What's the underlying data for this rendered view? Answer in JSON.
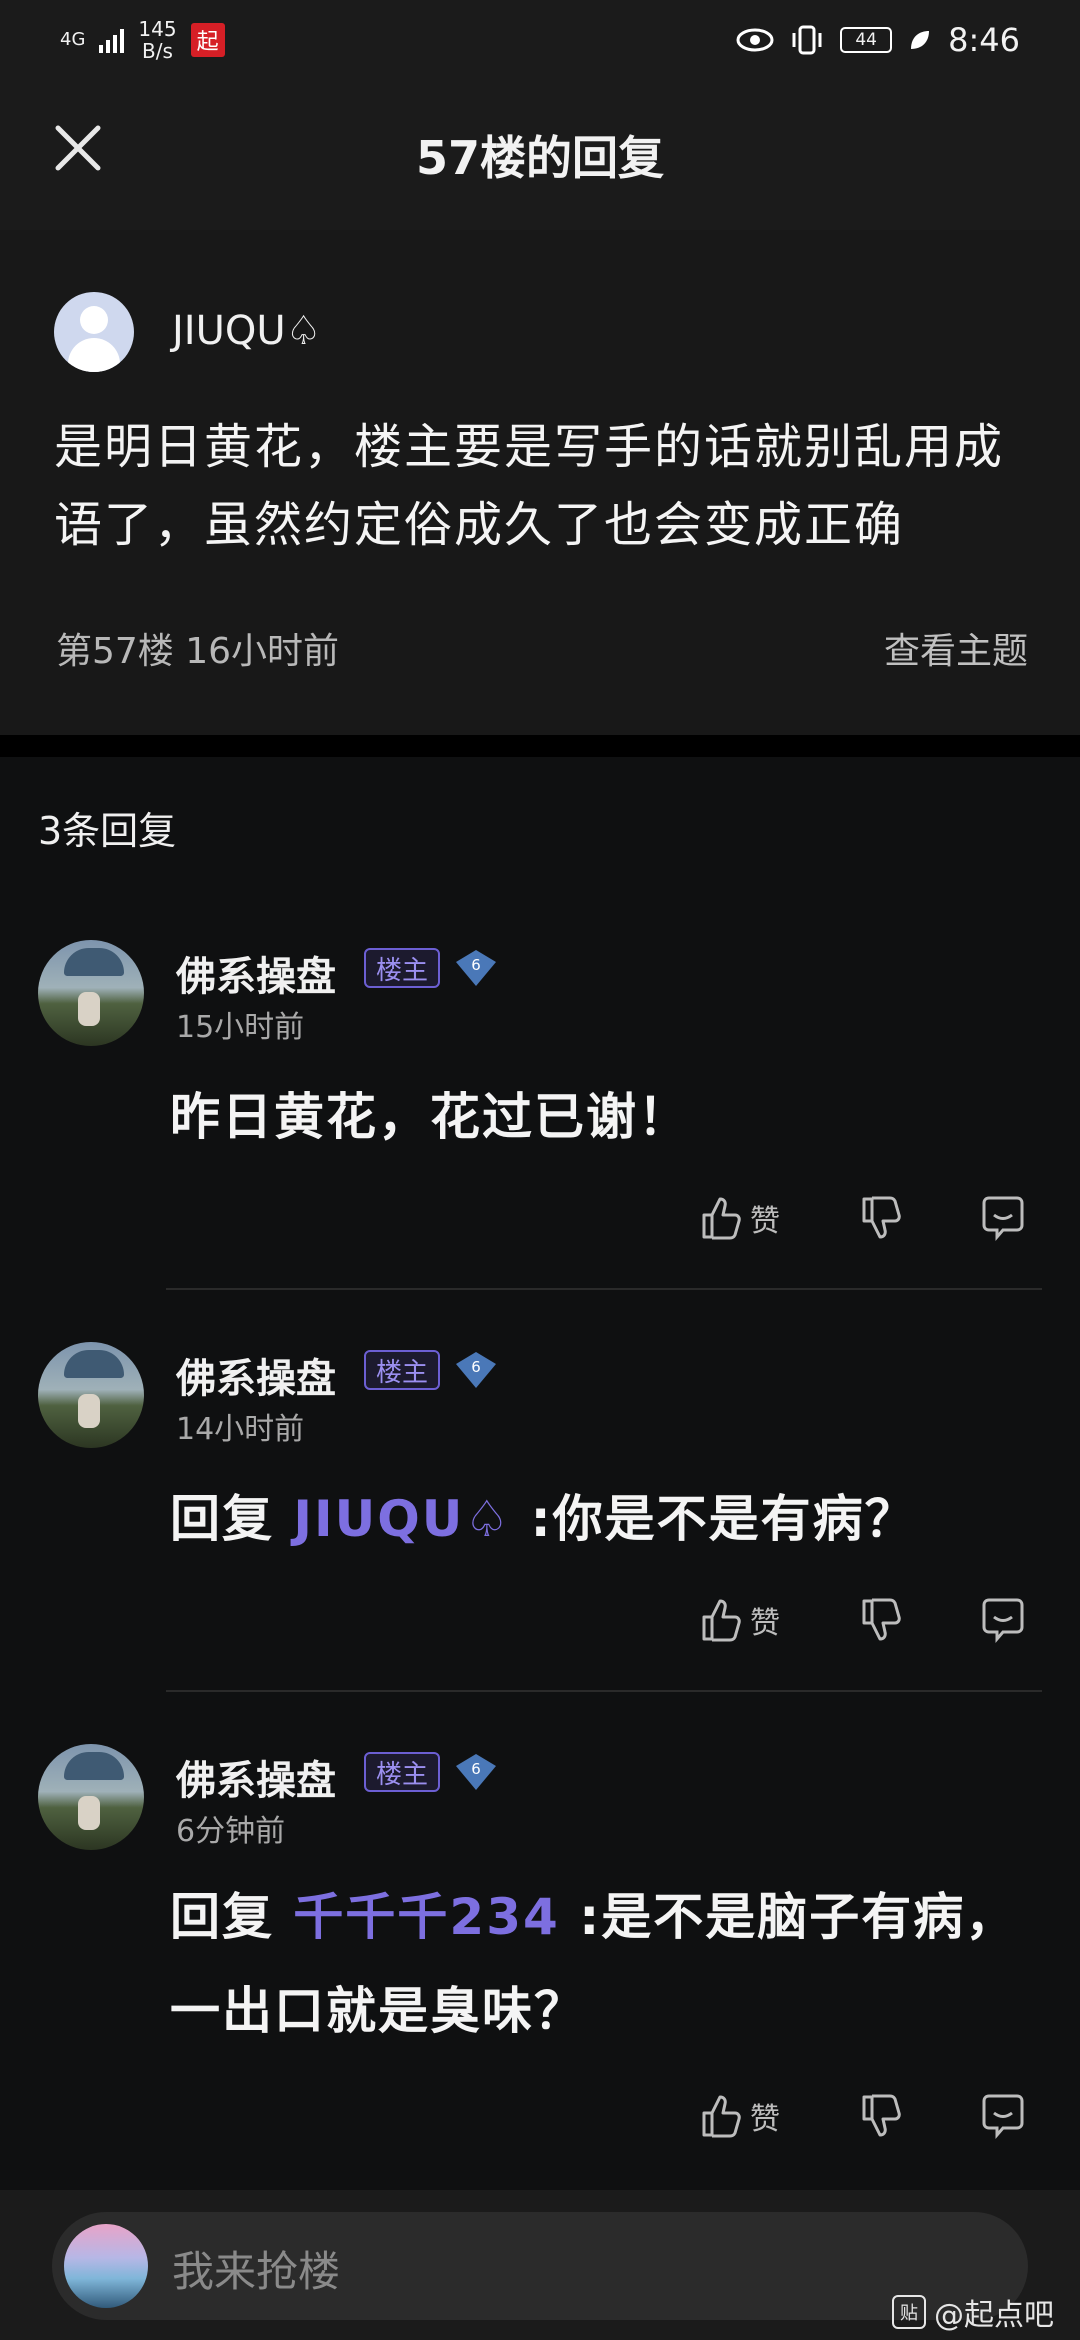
{
  "status_bar": {
    "network": "4G",
    "speed_value": "145",
    "speed_unit": "B/s",
    "app_badge": "起",
    "battery": "44",
    "time": "8:46"
  },
  "header": {
    "title": "57楼的回复"
  },
  "original_post": {
    "username": "JIUQU♤",
    "content": "是明日黄花，楼主要是写手的话就别乱用成语了，虽然约定俗成久了也会变成正确",
    "floor_time": "第57楼 16小时前",
    "view_topic": "查看主题"
  },
  "replies_count": "3条回复",
  "replies": [
    {
      "username": "佛系操盘",
      "owner_badge": "楼主",
      "level": "6",
      "time": "15小时前",
      "prefix": "",
      "mention": "",
      "content": "昨日黄花，花过已谢！",
      "like_label": "赞"
    },
    {
      "username": "佛系操盘",
      "owner_badge": "楼主",
      "level": "6",
      "time": "14小时前",
      "prefix": "回复 ",
      "mention": "JIUQU♤",
      "content": " :你是不是有病？",
      "like_label": "赞"
    },
    {
      "username": "佛系操盘",
      "owner_badge": "楼主",
      "level": "6",
      "time": "6分钟前",
      "prefix": "回复 ",
      "mention": "千千千234",
      "content": " :是不是脑子有病，一出口就是臭味？",
      "like_label": "赞"
    }
  ],
  "input": {
    "placeholder": "我来抢楼"
  },
  "watermark": {
    "icon": "贴",
    "text": "@起点吧"
  },
  "colors": {
    "accent": "#7d6fe0",
    "background": "#0f1011",
    "header": "#1b1b1b"
  }
}
